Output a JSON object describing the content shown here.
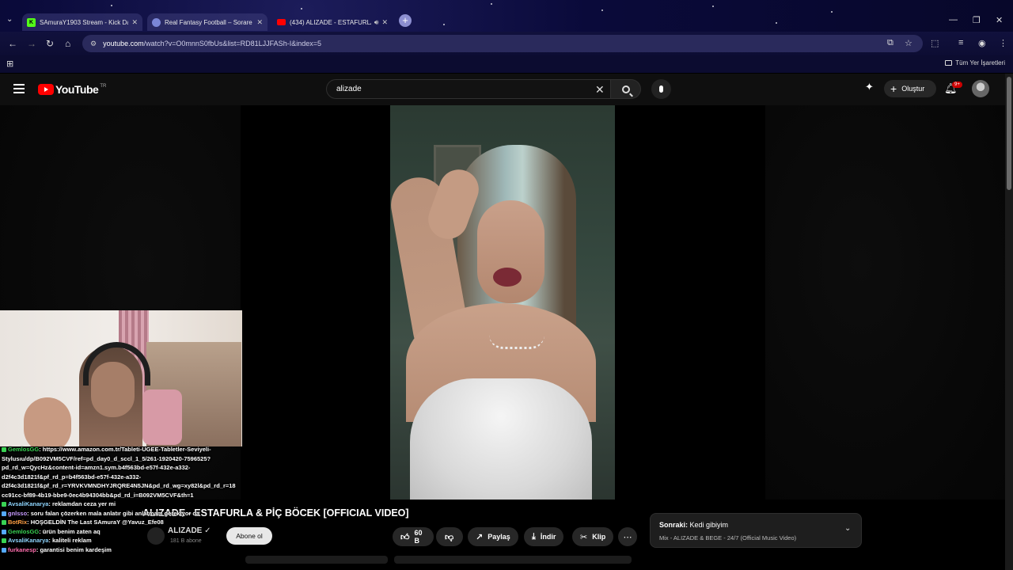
{
  "browser": {
    "tabs": [
      {
        "title": "SAmuraY1903 Stream - Kick Da",
        "favicon": "kick-icon",
        "color": "#53fc18"
      },
      {
        "title": "Real Fantasy Football – Sorare",
        "favicon": "sorare-icon",
        "color": "#7b86d6"
      },
      {
        "title": "(434) ALIZADE - ESTAFURLA",
        "favicon": "youtube-icon",
        "color": "#ff0000"
      }
    ],
    "url_host": "youtube.com",
    "url_path": "/watch?v=O0mnnS0fbUs&list=RD81LJJFASh-I&index=5",
    "bookmarks_all": "Tüm Yer İşaretleri"
  },
  "youtube": {
    "logo_text": "YouTube",
    "logo_country": "TR",
    "search_value": "alizade",
    "create_label": "Oluştur",
    "notification_count": "9+",
    "video_title": "ALIZADE - ESTAFURLA & PİÇ BÖCEK [OFFICIAL VIDEO]",
    "channel_name": "ALIZADE",
    "subscribers": "181 B abone",
    "subscribe_label": "Abone ol",
    "like_count": "60 B",
    "share_label": "Paylaş",
    "download_label": "İndir",
    "clip_label": "Klip",
    "up_next_prefix": "Sonraki:",
    "up_next_title": "Kedi gibiyim",
    "up_next_mix": "Mix - ALIZADE & BEGE - 24/7 (Official Music Video)"
  },
  "chat": [
    {
      "user": "GemlosGG",
      "text": ": https://www.amazon.com.tr/Tableti-UGEE-Tabletler-Seviyeli-",
      "color": "#39d353"
    },
    {
      "user": "",
      "text": "Stylusıu/dp/B092VM5CVF/ref=pd_day0_d_sccl_1_5/261-1920420-7596525?",
      "color": ""
    },
    {
      "user": "",
      "text": "pd_rd_w=QycHz&content-id=amzn1.sym.b4f563bd-e57f-432e-a332-",
      "color": ""
    },
    {
      "user": "",
      "text": "d2f4c3d1821f&pf_rd_p=b4f563bd-e57f-432e-a332-",
      "color": ""
    },
    {
      "user": "",
      "text": "d2f4c3d1821f&pf_rd_r=YRVKVMNDHYJRQRE4N5JN&pd_rd_wg=xy82l&pd_rd_r=18",
      "color": ""
    },
    {
      "user": "",
      "text": "cc91cc-bf89-4b19-bbe9-0ec4b94304bb&pd_rd_i=B092VM5CVF&th=1",
      "color": ""
    },
    {
      "user": "AvsaliKanarya",
      "text": ": reklamdan ceza yer mi",
      "color": "#8fd6ff"
    },
    {
      "user": "gnlsso",
      "text": ": soru falan çözerken mala anlatır gibi anlatmam gerekiyor da",
      "color": "#c79bff"
    },
    {
      "user": "BotRix",
      "text": ": HOŞGELDİN The Last SAmuraY @Yavuz_Efe08",
      "color": "#ff9f43"
    },
    {
      "user": "GemlosGG",
      "text": ": ürün benim zaten aq",
      "color": "#39d353"
    },
    {
      "user": "AvsaliKanarya",
      "text": ": kaliteli reklam",
      "color": "#8fd6ff"
    },
    {
      "user": "furkanesp",
      "text": ": garantisi benim kardeşim",
      "color": "#ff6fae"
    }
  ]
}
